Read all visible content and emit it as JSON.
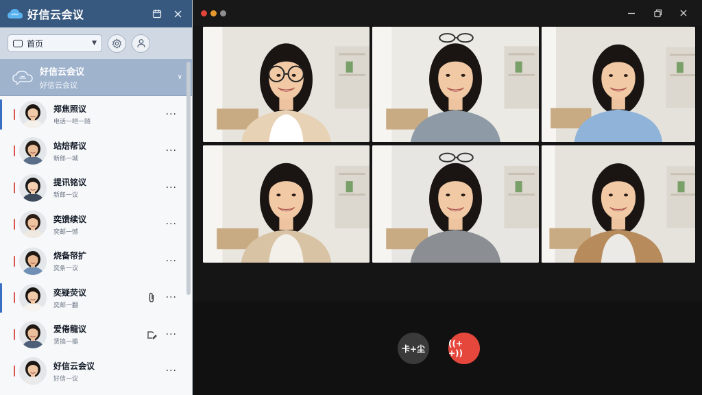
{
  "app": {
    "title": "好信云会议",
    "colors": {
      "sidebar_header": "#38597f",
      "active_border": "#8bd26b",
      "hangup": "#e5473c"
    }
  },
  "sidebar": {
    "header_icons": [
      "calendar-icon",
      "close-icon"
    ],
    "filter": {
      "label": "首页",
      "icon": "calendar-icon"
    },
    "toolbar_icons": [
      "settings-icon",
      "user-icon"
    ],
    "group": {
      "name": "好信云会议",
      "subtitle": "好信云会议"
    },
    "items": [
      {
        "name": "郑焦照议",
        "sub": "电话一吧一随",
        "marker": true,
        "tick": true,
        "extra": "",
        "more": "···"
      },
      {
        "name": "站焙帮议",
        "sub": "新郎一城",
        "marker": false,
        "tick": true,
        "extra": "",
        "more": "···"
      },
      {
        "name": "提讯铭议",
        "sub": "新郎一议",
        "marker": false,
        "tick": true,
        "extra": "",
        "more": "···"
      },
      {
        "name": "奕馈续议",
        "sub": "奕邮一憾",
        "marker": false,
        "tick": true,
        "extra": "",
        "more": "···"
      },
      {
        "name": "烧备帑扩",
        "sub": "奕条一议",
        "marker": false,
        "tick": true,
        "extra": "",
        "more": "···"
      },
      {
        "name": "奕疑荧议",
        "sub": "奕邮一翻",
        "marker": true,
        "tick": true,
        "extra": "attachment-icon",
        "more": "···"
      },
      {
        "name": "爱倦龍议",
        "sub": "赁搞一瓣",
        "marker": false,
        "tick": true,
        "extra": "edit-icon",
        "more": "···"
      },
      {
        "name": "好信云会议",
        "sub": "好信一议",
        "marker": false,
        "tick": true,
        "extra": "",
        "more": "···"
      }
    ]
  },
  "main": {
    "window_dots": [
      "#e0443a",
      "#e69a2e",
      "#8f8f8f"
    ],
    "window_controls": [
      "minimize-icon",
      "restore-icon",
      "close-icon"
    ],
    "tiles": [
      {
        "name": "participant-1",
        "active": false
      },
      {
        "name": "participant-2",
        "active": true
      },
      {
        "name": "participant-3",
        "active": false
      },
      {
        "name": "participant-4",
        "active": false
      },
      {
        "name": "participant-5",
        "active": false
      },
      {
        "name": "participant-6",
        "active": false
      }
    ],
    "controls": {
      "mute_label": "卡+尘",
      "hangup_label": "((+ +))"
    }
  }
}
